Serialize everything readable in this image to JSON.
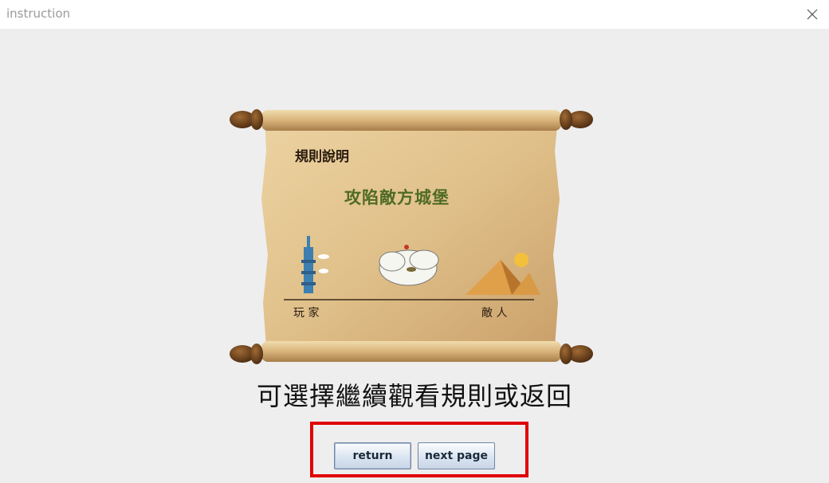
{
  "window": {
    "title": "instruction",
    "close_icon": "close-icon"
  },
  "scroll": {
    "heading": "規則說明",
    "subtitle": "攻陷敵方城堡",
    "player_label": "玩 家",
    "enemy_label": "敵 人"
  },
  "prompt": "可選擇繼續觀看規則或返回",
  "buttons": {
    "return_label": "return",
    "next_label": "next page"
  },
  "colors": {
    "background": "#eeeeee",
    "highlight": "#e00000",
    "parchment": "#e2c592",
    "subtitle": "#4f6b26"
  }
}
